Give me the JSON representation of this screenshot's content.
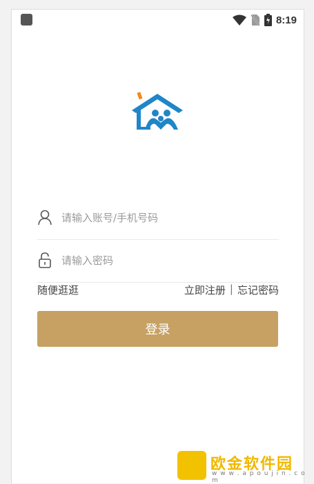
{
  "status_bar": {
    "time": "8:19",
    "icons": [
      "app-square-icon",
      "wifi-icon",
      "no-sim-icon",
      "battery-charging-icon"
    ]
  },
  "logo": {
    "icon": "house-family-logo-icon",
    "colors": {
      "blue": "#1f86c8",
      "orange": "#f08a1c"
    }
  },
  "form": {
    "account_placeholder": "请输入账号/手机号码",
    "password_placeholder": "请输入密码"
  },
  "links": {
    "browse": "随便逛逛",
    "register": "立即注册",
    "separator": "|",
    "forgot": "忘记密码"
  },
  "login_button": {
    "label": "登录",
    "color": "#c6a163"
  },
  "watermark": {
    "title": "欧金软件园",
    "url": "w w w . a p o u j i n . c o m"
  }
}
